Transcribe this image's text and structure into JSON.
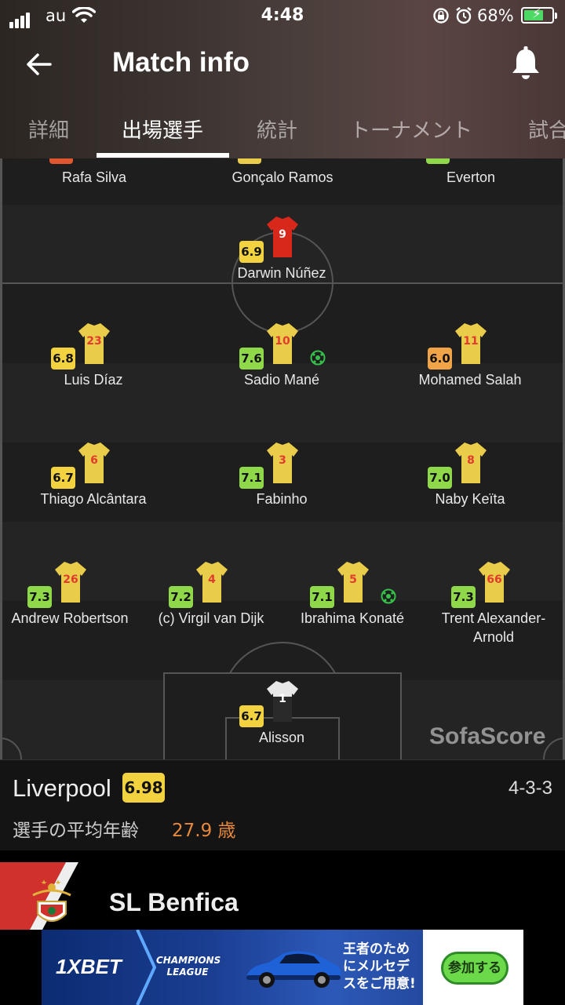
{
  "status_bar": {
    "carrier": "au",
    "time": "4:48",
    "battery": "68%"
  },
  "header": {
    "title": "Match info"
  },
  "tabs": [
    {
      "label": "詳細"
    },
    {
      "label": "出場選手"
    },
    {
      "label": "統計"
    },
    {
      "label": "トーナメント"
    },
    {
      "label": "試合"
    }
  ],
  "colors": {
    "accent_yellow": "#f2d23f",
    "rating_green": "#8ed84a",
    "rating_orange": "#f0a347",
    "shirt_red": "#d8281c",
    "shirt_yellow": "#e9cc4a"
  },
  "opponent_partial_players": [
    {
      "name": "Rafa Silva"
    },
    {
      "name": "Gonçalo Ramos"
    },
    {
      "name": "Everton"
    }
  ],
  "opponent_striker": {
    "name": "Darwin Núñez",
    "number": "9",
    "rating": "6.9"
  },
  "forwards": [
    {
      "name": "Luis Díaz",
      "number": "23",
      "rating": "6.8"
    },
    {
      "name": "Sadio Mané",
      "number": "10",
      "rating": "7.6",
      "goal": true
    },
    {
      "name": "Mohamed Salah",
      "number": "11",
      "rating": "6.0"
    }
  ],
  "midfielders": [
    {
      "name": "Thiago Alcântara",
      "number": "6",
      "rating": "6.7"
    },
    {
      "name": "Fabinho",
      "number": "3",
      "rating": "7.1"
    },
    {
      "name": "Naby Keïta",
      "number": "8",
      "rating": "7.0"
    }
  ],
  "defenders": [
    {
      "name": "Andrew Robertson",
      "number": "26",
      "rating": "7.3"
    },
    {
      "name": "(c) Virgil van Dijk",
      "number": "4",
      "rating": "7.2"
    },
    {
      "name": "Ibrahima Konaté",
      "number": "5",
      "rating": "7.1",
      "goal": true
    },
    {
      "name": "Trent Alexander-Arnold",
      "number": "66",
      "rating": "7.3"
    }
  ],
  "goalkeeper": {
    "name": "Alisson",
    "number": "1",
    "rating": "6.7"
  },
  "watermark": "SofaScore",
  "team": {
    "name": "Liverpool",
    "rating": "6.98",
    "formation": "4-3-3",
    "avg_age_label": "選手の平均年齢",
    "avg_age_value": "27.9 歳"
  },
  "opponent_team": {
    "name": "SL Benfica"
  },
  "ad": {
    "brand": "1XBET",
    "league": "CHAMPIONS LEAGUE",
    "copy": "王者のためにメルセデスをご用意!",
    "cta": "参加する"
  }
}
